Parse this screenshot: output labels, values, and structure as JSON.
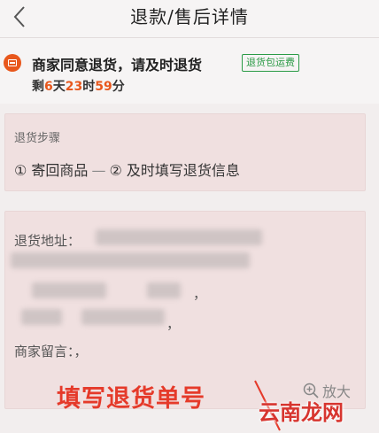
{
  "header": {
    "back_icon": "chevron-left-icon",
    "title": "退款/售后详情"
  },
  "status": {
    "icon": "return-box-icon",
    "icon_color": "#e8571c",
    "title": "商家同意退货，请及时退货",
    "badge": "退货包运费",
    "badge_color": "#2a9a45",
    "countdown_prefix": "剩",
    "days": "6",
    "days_unit": "天",
    "hours": "23",
    "hours_unit": "时",
    "minutes": "59",
    "minutes_unit": "分"
  },
  "steps": {
    "label": "退货步骤",
    "step1": "① 寄回商品",
    "separator": "—",
    "step2": "② 及时填写退货信息"
  },
  "address": {
    "label": "退货地址：",
    "comma_1": "，",
    "comma_2": "，",
    "note_label": "商家留言：，",
    "zoom_icon": "zoom-in-icon",
    "zoom_label": "放大"
  },
  "annotation": {
    "text": "填写退货单号",
    "color": "#e53a2a"
  },
  "watermark": {
    "text": "云南龙网"
  }
}
